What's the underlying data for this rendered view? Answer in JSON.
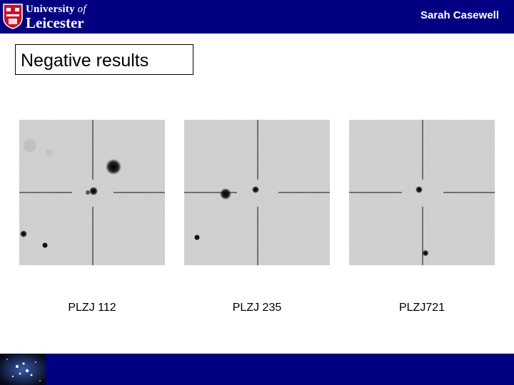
{
  "header": {
    "logo": {
      "line1_main": "University",
      "line1_of": "of",
      "line2": "Leicester"
    },
    "author": "Sarah Casewell"
  },
  "slide": {
    "title": "Negative results"
  },
  "panels": [
    {
      "caption": "PLZJ 112"
    },
    {
      "caption": "PLZJ 235"
    },
    {
      "caption": "PLZJ721"
    }
  ],
  "colors": {
    "bar": "#000080",
    "text": "#000000",
    "background": "#ffffff",
    "image_grey": "#d4d4d4"
  },
  "icons": {
    "crest": "university-shield-icon",
    "footer_image": "pleiades-star-cluster-icon"
  }
}
